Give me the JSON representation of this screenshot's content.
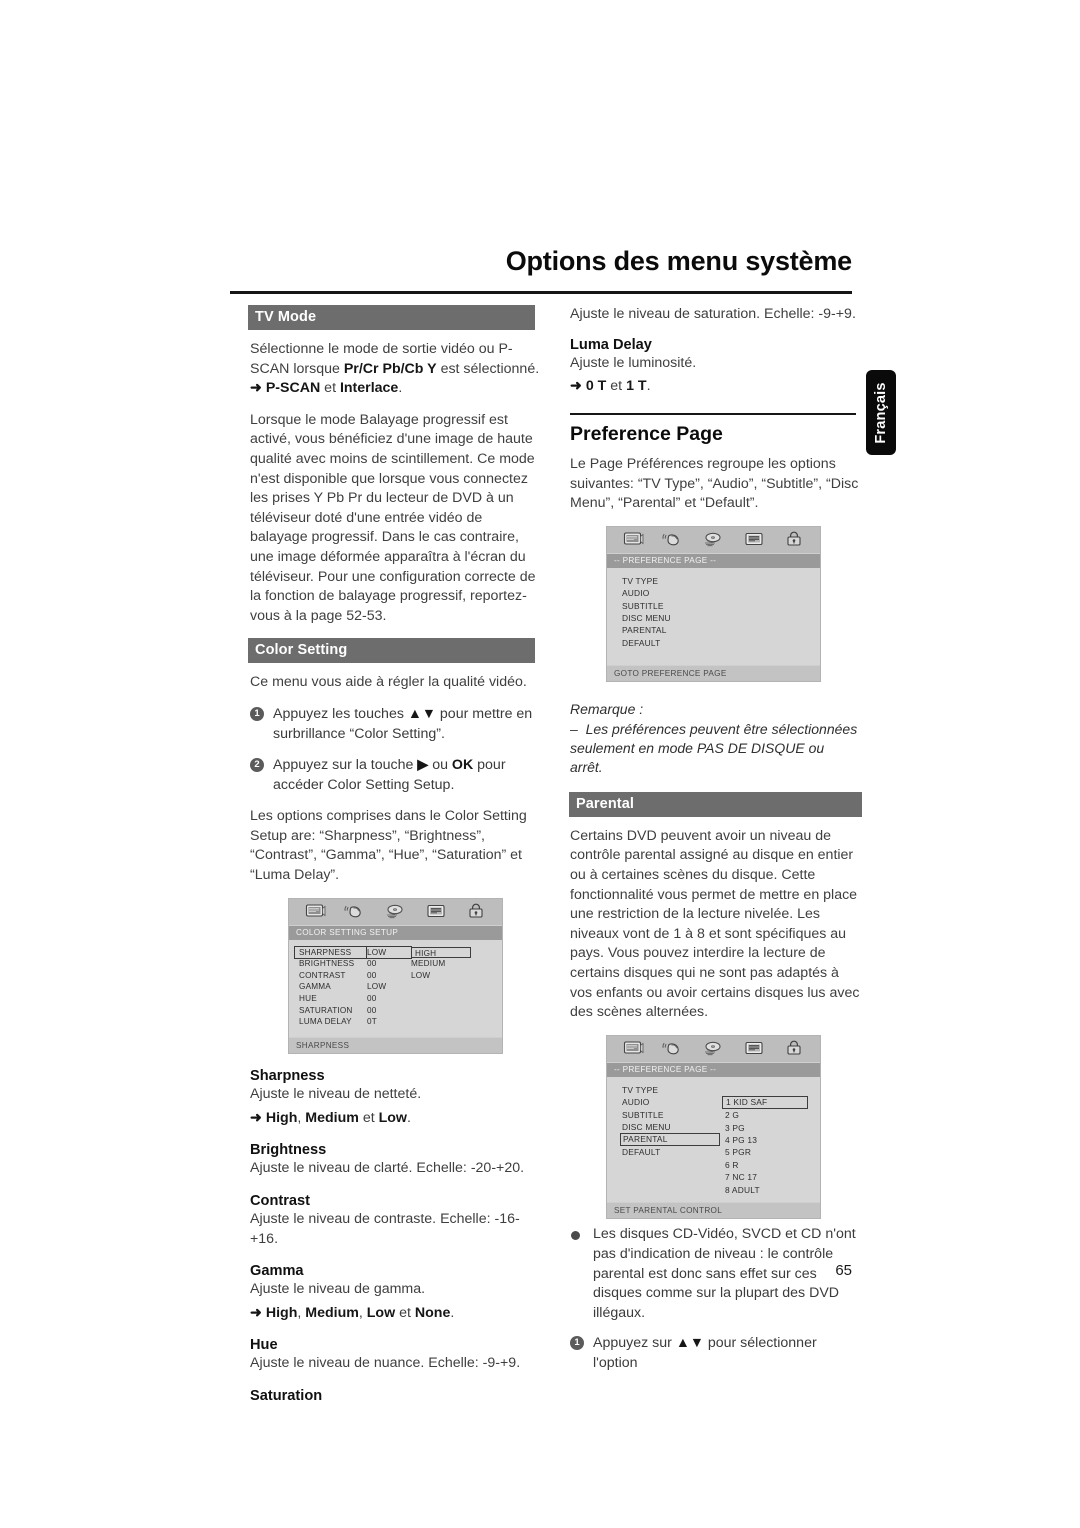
{
  "document": {
    "title": "Options des menu système",
    "language_tab": "Français",
    "page_number": "65"
  },
  "left_column": {
    "tv_mode": {
      "heading": "TV Mode",
      "para1_a": "Sélectionne le mode de sortie vidéo ou P-SCAN lorsque ",
      "para1_bold": "Pr/Cr Pb/Cb Y",
      "para1_b": " est sélectionné.",
      "arrow": "➜",
      "opt1": "P-SCAN",
      "opt_join": " et ",
      "opt2": "Interlace",
      "opt_end": ".",
      "para2": "Lorsque le mode Balayage progressif est activé, vous bénéficiez d'une image de haute qualité avec moins de scintillement. Ce mode n'est disponible que lorsque vous connectez les prises Y Pb Pr du lecteur de DVD à un téléviseur doté d'une entrée vidéo de balayage progressif. Dans le cas contraire, une image déformée apparaîtra à l'écran du téléviseur. Pour une configuration correcte de la fonction de balayage progressif, reportez-vous à la page 52-53."
    },
    "color_setting": {
      "heading": "Color Setting",
      "intro": "Ce menu vous aide à régler la qualité vidéo.",
      "step1_num": "1",
      "step1_a": "Appuyez les touches ",
      "step1_icons": "▲▼",
      "step1_b": "  pour mettre en surbrillance “Color Setting”.",
      "step2_num": "2",
      "step2_a": "Appuyez sur la touche ",
      "step2_arrow": "▶",
      "step2_b": " ou ",
      "step2_bold": "OK",
      "step2_c": " pour accéder Color Setting Setup.",
      "para": "Les options comprises dans le Color Setting Setup are: “Sharpness”, “Brightness”, “Contrast”, “Gamma”, “Hue”, “Saturation” et “Luma Delay”."
    },
    "osd_color_setting": {
      "title": "COLOR SETTING SETUP",
      "footer": "SHARPNESS",
      "icons": [
        "tv-screen-icon",
        "speaker-audio-icon",
        "video-disc-icon",
        "subtitle-text-icon",
        "lock-icon"
      ],
      "rows": [
        {
          "label": "SHARPNESS",
          "value": "LOW",
          "option": "HIGH",
          "selected": true
        },
        {
          "label": "BRIGHTNESS",
          "value": "00",
          "option": "MEDIUM",
          "selected": false
        },
        {
          "label": "CONTRAST",
          "value": "00",
          "option": "LOW",
          "selected": false
        },
        {
          "label": "GAMMA",
          "value": "LOW",
          "option": "",
          "selected": false
        },
        {
          "label": "HUE",
          "value": "00",
          "option": "",
          "selected": false
        },
        {
          "label": "SATURATION",
          "value": "00",
          "option": "",
          "selected": false
        },
        {
          "label": "LUMA DELAY",
          "value": "0T",
          "option": "",
          "selected": false
        }
      ]
    },
    "definitions": [
      {
        "term": "Sharpness",
        "desc": "Ajuste le niveau de netteté.",
        "arrow": "➜",
        "options_html": "<b>High</b>, <b>Medium</b> et <b>Low</b>."
      },
      {
        "term": "Brightness",
        "desc": "Ajuste le niveau de clarté. Echelle: -20-+20.",
        "arrow": "",
        "options_html": ""
      },
      {
        "term": "Contrast",
        "desc": "Ajuste le niveau de contraste. Echelle: -16-+16.",
        "arrow": "",
        "options_html": ""
      },
      {
        "term": "Gamma",
        "desc": "Ajuste le niveau de gamma.",
        "arrow": "➜",
        "options_html": "<b>High</b>, <b>Medium</b>, <b>Low</b> et <b>None</b>."
      },
      {
        "term": "Hue",
        "desc": "Ajuste le niveau de nuance. Echelle: -9-+9.",
        "arrow": "",
        "options_html": ""
      },
      {
        "term": "Saturation",
        "desc": "",
        "arrow": "",
        "options_html": ""
      }
    ]
  },
  "right_column": {
    "saturation_desc": "Ajuste le niveau de saturation. Echelle: -9-+9.",
    "luma_delay": {
      "term": "Luma Delay",
      "desc": "Ajuste le luminosité.",
      "arrow": "➜",
      "opt1": "0 T",
      "opt_join": " et ",
      "opt2": "1 T",
      "opt_end": "."
    },
    "preference_page": {
      "heading": "Preference Page",
      "para": "Le Page Préférences regroupe les options suivantes: “TV Type”, “Audio”, “Subtitle”, “Disc Menu”, “Parental” et “Default”."
    },
    "osd_preference": {
      "title": "-- PREFERENCE PAGE --",
      "footer": "GOTO PREFERENCE PAGE",
      "icons": [
        "tv-screen-icon",
        "speaker-audio-icon",
        "video-disc-icon",
        "subtitle-text-icon",
        "lock-icon"
      ],
      "items": [
        "TV TYPE",
        "AUDIO",
        "SUBTITLE",
        "DISC MENU",
        "PARENTAL",
        "DEFAULT"
      ]
    },
    "note": {
      "label": "Remarque :",
      "dash": "–",
      "text": "Les préférences peuvent être sélectionnées seulement en mode PAS DE DISQUE ou arrêt."
    },
    "parental": {
      "heading": "Parental",
      "para": "Certains DVD peuvent avoir un niveau de contrôle parental assigné au disque en entier ou à certaines scènes du disque. Cette fonctionnalité vous permet de mettre en place une restriction de la lecture nivelée. Les niveaux vont de 1 à 8 et sont spécifiques au pays. Vous pouvez interdire la lecture de certains disques qui ne sont pas adaptés à vos enfants ou avoir certains disques lus avec des scènes alternées."
    },
    "osd_parental": {
      "title": "-- PREFERENCE PAGE --",
      "footer": "SET PARENTAL CONTROL",
      "icons": [
        "tv-screen-icon",
        "speaker-audio-icon",
        "video-disc-icon",
        "subtitle-text-icon",
        "lock-icon"
      ],
      "items": [
        "TV TYPE",
        "AUDIO",
        "SUBTITLE",
        "DISC MENU",
        "PARENTAL",
        "DEFAULT"
      ],
      "selected_item": "PARENTAL",
      "ratings": [
        "1 KID SAF",
        "2 G",
        "3 PG",
        "4 PG 13",
        "5 PGR",
        "6 R",
        "7 NC 17",
        "8 ADULT"
      ],
      "selected_rating": "1 KID SAF"
    },
    "bullet": {
      "text": "Les disques CD-Vidéo, SVCD et CD n'ont pas d'indication de niveau : le contrôle parental est donc sans effet sur ces disques comme sur la plupart des DVD illégaux."
    },
    "step": {
      "num": "1",
      "a": "Appuyez sur ",
      "icons": "▲▼",
      "b": "  pour sélectionner l'option"
    }
  }
}
